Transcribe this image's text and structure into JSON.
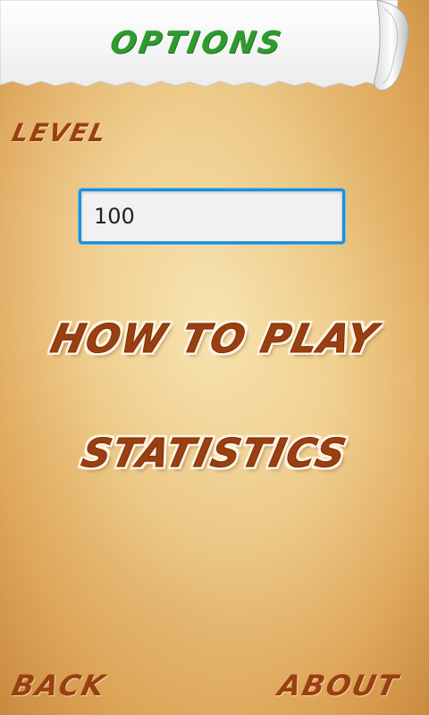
{
  "header": {
    "title": "OPTIONS"
  },
  "level": {
    "label": "LEVEL",
    "input_value": "100"
  },
  "menu": {
    "how_to_play": "HOW TO PLAY",
    "statistics": "STATISTICS"
  },
  "footer": {
    "back": "BACK",
    "about": "ABOUT"
  },
  "colors": {
    "title_green": "#2e9b2e",
    "label_brown": "#9a3f12",
    "input_border": "#1f8fd6",
    "paper_light": "#f7e2ad",
    "paper_dark": "#c98a3f"
  }
}
